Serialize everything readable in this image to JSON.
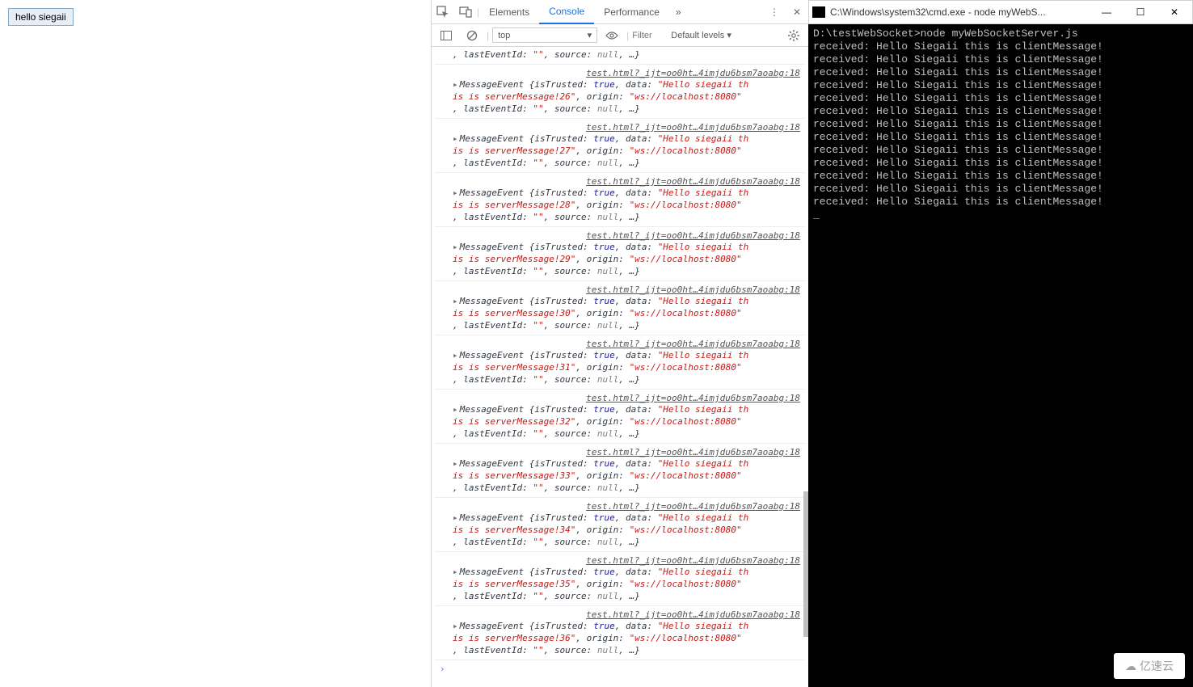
{
  "page": {
    "buttonLabel": "hello siegaii"
  },
  "devtools": {
    "tabs": {
      "elements": "Elements",
      "console": "Console",
      "performance": "Performance"
    },
    "more": "»",
    "contextSelector": "top",
    "filterPlaceholder": "Filter",
    "levels": "Default levels ▾",
    "sourceLink": "test.html?_ijt=oo0ht…4imjdu6bsm7aoabg:18",
    "logPrefix": "MessageEvent ",
    "openBrace": "{",
    "isTrustedKey": "isTrusted: ",
    "trueVal": "true",
    "dataKey": ", data: ",
    "dataPart1": "\"Hello siegaii th",
    "dataPart2a": "is is serverMessage!",
    "dataPart2b": "\"",
    "originKey": ", origin: ",
    "originVal": "\"ws://localhost:8080\"",
    "lastKey": ", lastEventId: ",
    "lastVal": "\"\"",
    "sourceKey": ", source: ",
    "nullVal": "null",
    "tail": ", …}",
    "promptGlyph": "›",
    "entries": [
      26,
      27,
      28,
      29,
      30,
      31,
      32,
      33,
      34,
      35,
      36
    ]
  },
  "cmd": {
    "title": "C:\\Windows\\system32\\cmd.exe - node  myWebS...",
    "firstLine": "D:\\testWebSocket>node myWebSocketServer.js",
    "recvLine": "received: Hello Siegaii this is clientMessage!",
    "recvCount": 13
  },
  "watermark": "亿速云"
}
